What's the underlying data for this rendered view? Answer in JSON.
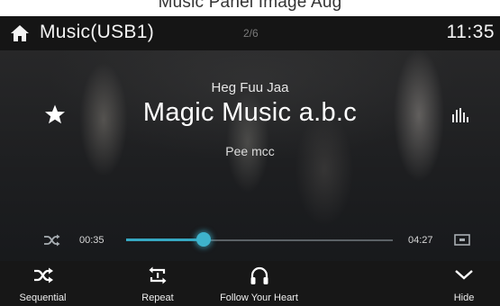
{
  "caption": "Music Panel Image Aug",
  "header": {
    "title": "Music(USB1)",
    "track_count": "2/6",
    "clock": "11:35"
  },
  "now_playing": {
    "artist": "Heg Fuu Jaa",
    "song": "Magic Music a.b.c",
    "album": "Pee mcc",
    "elapsed": "00:35",
    "total": "04:27",
    "progress_fraction": 0.29
  },
  "bottom_bar": {
    "sequential_label": "Sequential",
    "repeat_label": "Repeat",
    "source_label": "Follow Your Heart",
    "hide_label": "Hide"
  },
  "colors": {
    "accent": "#36a8c2",
    "header_bg": "#151515",
    "bottom_bg": "#171717"
  },
  "icons": [
    "home-icon",
    "star-icon",
    "equalizer-icon",
    "shuffle-icon",
    "repeat-icon",
    "headphones-icon",
    "chevron-down-icon"
  ]
}
